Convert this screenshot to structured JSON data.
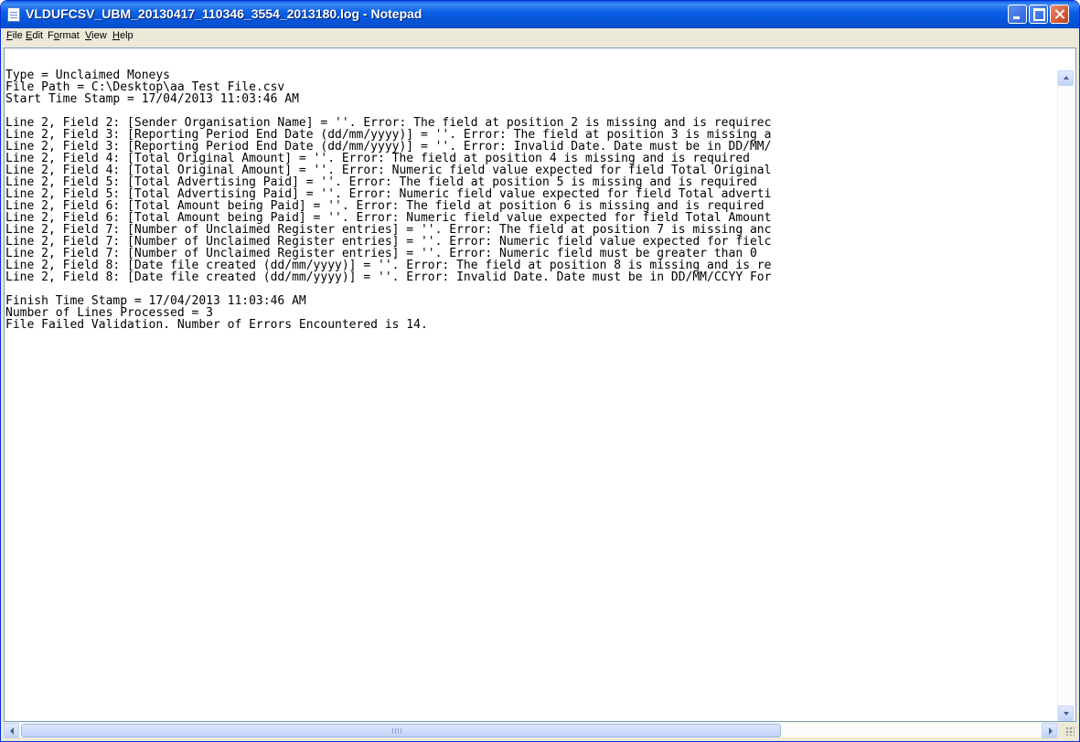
{
  "window": {
    "title": "VLDUFCSV_UBM_20130417_110346_3554_2013180.log - Notepad"
  },
  "menu": {
    "file": {
      "u": "F",
      "rest": "ile"
    },
    "edit": {
      "u": "E",
      "rest": "dit"
    },
    "format_pre": "F",
    "format_u": "o",
    "format_rest": "rmat",
    "view": {
      "u": "V",
      "rest": "iew"
    },
    "help": {
      "u": "H",
      "rest": "elp"
    }
  },
  "content": {
    "lines": [
      "Type = Unclaimed Moneys",
      "File Path = C:\\Desktop\\aa Test File.csv",
      "Start Time Stamp = 17/04/2013 11:03:46 AM",
      "",
      "Line 2, Field 2: [Sender Organisation Name] = ''. Error: The field at position 2 is missing and is requirec",
      "Line 2, Field 3: [Reporting Period End Date (dd/mm/yyyy)] = ''. Error: The field at position 3 is missing a",
      "Line 2, Field 3: [Reporting Period End Date (dd/mm/yyyy)] = ''. Error: Invalid Date. Date must be in DD/MM/",
      "Line 2, Field 4: [Total Original Amount] = ''. Error: The field at position 4 is missing and is required",
      "Line 2, Field 4: [Total Original Amount] = ''. Error: Numeric field value expected for field Total Original",
      "Line 2, Field 5: [Total Advertising Paid] = ''. Error: The field at position 5 is missing and is required",
      "Line 2, Field 5: [Total Advertising Paid] = ''. Error: Numeric field value expected for field Total adverti",
      "Line 2, Field 6: [Total Amount being Paid] = ''. Error: The field at position 6 is missing and is required",
      "Line 2, Field 6: [Total Amount being Paid] = ''. Error: Numeric field value expected for field Total Amount",
      "Line 2, Field 7: [Number of Unclaimed Register entries] = ''. Error: The field at position 7 is missing anc",
      "Line 2, Field 7: [Number of Unclaimed Register entries] = ''. Error: Numeric field value expected for fielc",
      "Line 2, Field 7: [Number of Unclaimed Register entries] = ''. Error: Numeric field must be greater than 0",
      "Line 2, Field 8: [Date file created (dd/mm/yyyy)] = ''. Error: The field at position 8 is missing and is re",
      "Line 2, Field 8: [Date file created (dd/mm/yyyy)] = ''. Error: Invalid Date. Date must be in DD/MM/CCYY For",
      "",
      "Finish Time Stamp = 17/04/2013 11:03:46 AM",
      "Number of Lines Processed = 3",
      "File Failed Validation. Number of Errors Encountered is 14."
    ]
  },
  "colors": {
    "titlebar": "#0554d8",
    "frame": "#ece9d8",
    "editor_bg": "#ffffff",
    "text": "#000000"
  },
  "icons": [
    "notepad-icon",
    "minimize-icon",
    "maximize-icon",
    "close-icon",
    "scroll-up-icon",
    "scroll-down-icon",
    "scroll-left-icon",
    "scroll-right-icon",
    "resize-grip-icon"
  ]
}
